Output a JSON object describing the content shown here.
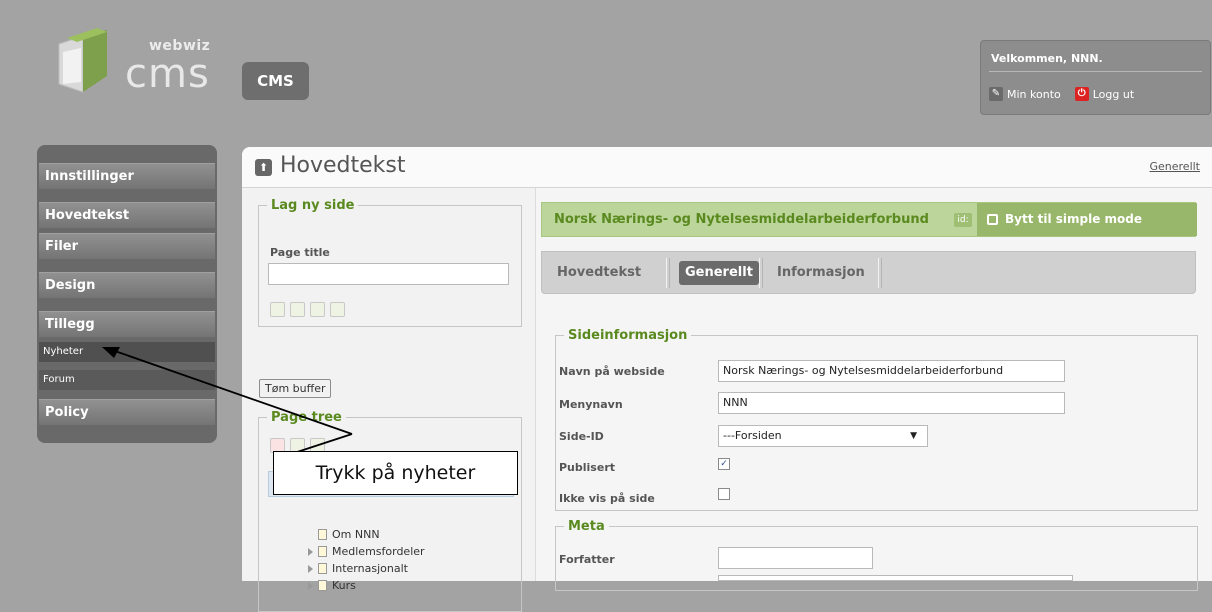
{
  "header": {
    "logo_word": "webwiz",
    "logo_cms": "cms",
    "cms_badge": "CMS",
    "welcome": "Velkommen, NNN.",
    "min_konto": "Min konto",
    "logg_ut": "Logg ut"
  },
  "sidebar": {
    "items": [
      "Innstillinger",
      "Hovedtekst",
      "Filer",
      "Design",
      "Tillegg"
    ],
    "sub_items": [
      "Nyheter",
      "Forum"
    ],
    "policy": "Policy"
  },
  "main": {
    "title": "Hovedtekst",
    "top_link": "Generellt",
    "lag_ny_side": {
      "legend": "Lag ny side",
      "page_title_label": "Page title",
      "page_title_value": ""
    },
    "tom_buffer": "Tøm buffer",
    "page_tree": {
      "legend": "Page tree",
      "items": [
        {
          "label": "Om NNN",
          "expandable": false
        },
        {
          "label": "Medlemsfordeler",
          "expandable": true
        },
        {
          "label": "Internasjonalt",
          "expandable": true
        },
        {
          "label": "Kurs",
          "expandable": true
        }
      ]
    },
    "org_title": "Norsk Nærings- og Nytelsesmiddelarbeiderforbund",
    "id_tag": "id:",
    "bytt_label": "Bytt til simple mode",
    "tabs": [
      "Hovedtekst",
      "Generellt",
      "Informasjon"
    ],
    "active_tab": "Generellt",
    "sideinfo": {
      "legend": "Sideinformasjon",
      "navn_label": "Navn på webside",
      "navn_value": "Norsk Nærings- og Nytelsesmiddelarbeiderforbund",
      "menynavn_label": "Menynavn",
      "menynavn_value": "NNN",
      "side_id_label": "Side-ID",
      "side_id_value": "---Forsiden",
      "publisert_label": "Publisert",
      "publisert_checked": true,
      "ikke_vis_label": "Ikke vis på side",
      "ikke_vis_checked": false
    },
    "meta": {
      "legend": "Meta",
      "forfatter_label": "Forfatter",
      "forfatter_value": ""
    }
  },
  "annotation": {
    "callout": "Trykk på nyheter"
  },
  "colors": {
    "accent_green": "#5a8a1f",
    "green_bar": "#bcd59a",
    "sidebar_bg": "#696969",
    "page_bg": "#a3a3a3"
  }
}
